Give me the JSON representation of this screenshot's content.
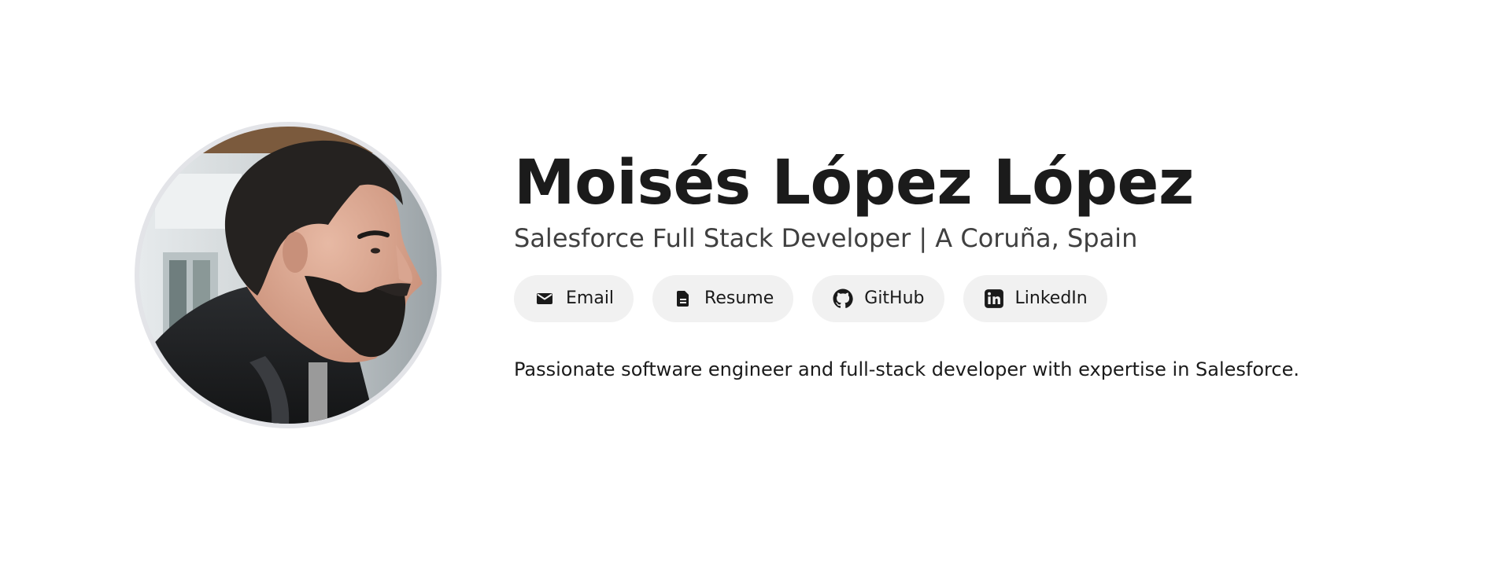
{
  "profile": {
    "name": "Moisés López López",
    "subtitle": "Salesforce Full Stack Developer | A Coruña, Spain",
    "bio": "Passionate software engineer and full-stack developer with expertise in Salesforce.",
    "avatar_icon": "profile-photo"
  },
  "links": [
    {
      "label": "Email",
      "icon": "envelope-icon"
    },
    {
      "label": "Resume",
      "icon": "document-icon"
    },
    {
      "label": "GitHub",
      "icon": "github-icon"
    },
    {
      "label": "LinkedIn",
      "icon": "linkedin-icon"
    }
  ],
  "colors": {
    "text": "#1b1b1b",
    "subtitle": "#404040",
    "button_bg": "#f1f1f1",
    "avatar_border": "#e3e4e8",
    "background": "#ffffff"
  }
}
